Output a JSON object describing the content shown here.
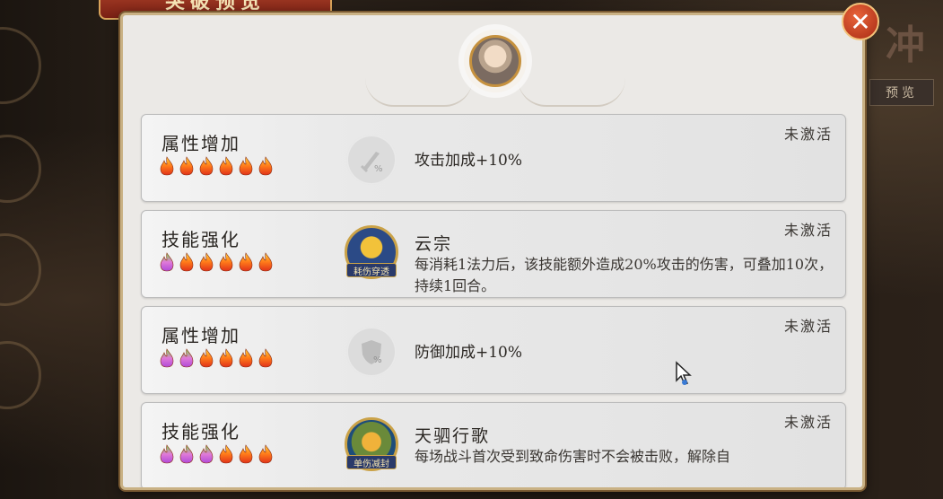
{
  "window": {
    "title": "突破预览",
    "side_tab": "预览",
    "side_glyph": "冲"
  },
  "close_label": "✕",
  "cards": [
    {
      "category": "属性增加",
      "status": "未激活",
      "type": "attribute",
      "icon": "sword-icon",
      "text": "攻击加成+10%",
      "flames": [
        "orange",
        "orange",
        "orange",
        "orange",
        "orange",
        "orange"
      ]
    },
    {
      "category": "技能强化",
      "status": "未激活",
      "type": "skill",
      "icon": "golden-horse-skill-icon",
      "tag": "耗伤穿透",
      "name": "云宗",
      "text": "每消耗1法力后，该技能额外造成20%攻击的伤害，可叠加10次，持续1回合。",
      "flames": [
        "rainbow",
        "orange",
        "orange",
        "orange",
        "orange",
        "orange"
      ]
    },
    {
      "category": "属性增加",
      "status": "未激活",
      "type": "attribute",
      "icon": "shield-icon",
      "text": "防御加成+10%",
      "flames": [
        "rainbow",
        "rainbow",
        "orange",
        "orange",
        "orange",
        "orange"
      ]
    },
    {
      "category": "技能强化",
      "status": "未激活",
      "type": "skill",
      "icon": "warrior-skill-icon",
      "tag": "单伤减封",
      "name": "天驷行歌",
      "text": "每场战斗首次受到致命伤害时不会被击败，解除自",
      "flames": [
        "rainbow",
        "rainbow",
        "rainbow",
        "orange",
        "orange",
        "orange"
      ]
    }
  ]
}
